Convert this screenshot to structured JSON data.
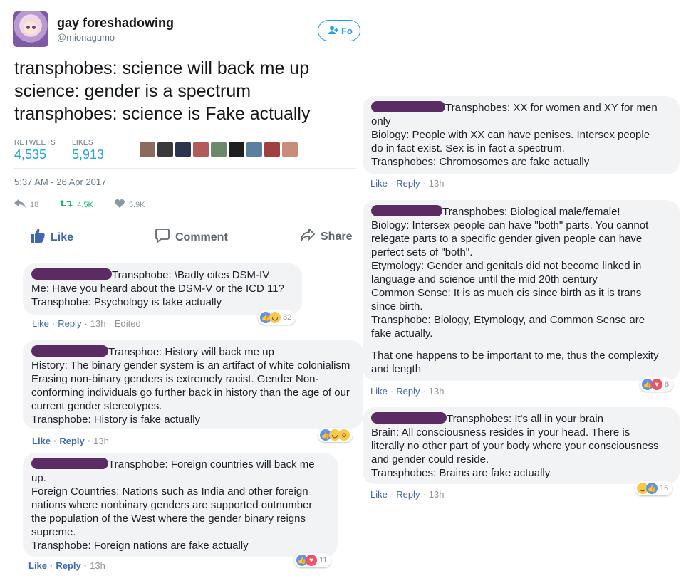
{
  "tweet": {
    "display_name": "gay foreshadowing",
    "handle": "@mionagumo",
    "follow_label": "Fo",
    "lines": [
      "transphobes: science will back me up",
      "science: gender is a spectrum",
      "transphobes: science is Fake actually"
    ],
    "retweets_label": "RETWEETS",
    "retweets_count": "4,535",
    "likes_label": "LIKES",
    "likes_count": "5,913",
    "timestamp": "5:37 AM - 26 Apr 2017",
    "reply_count": "18",
    "retweet_action_count": "4.5K",
    "like_action_count": "5.9K",
    "liker_avatar_colors": [
      "#8a6b5c",
      "#3a3a3a",
      "#2a3550",
      "#b35a5a",
      "#6a8a6a",
      "#1f1f1f",
      "#5a7fa0",
      "#a04040",
      "#c98b7a"
    ]
  },
  "facebook_bar": {
    "like_label": "Like",
    "comment_label": "Comment",
    "share_label": "Share"
  },
  "colors": {
    "twitter_blue": "#1da1f2",
    "facebook_blue": "#4267b2",
    "redaction": "#5b2b63",
    "bubble_bg": "#f2f3f5"
  },
  "left_comments": [
    {
      "lines": [
        "Transphobe: \\Badly cites DSM-IV",
        "Me: Have you heard about the DSM-V or the ICD 11?",
        "Transphobe: Psychology is fake actually"
      ],
      "like": "Like",
      "reply": "Reply",
      "time": "13h",
      "edited": "Edited",
      "reaction_count": "32"
    },
    {
      "lines": [
        "Transphoe: History will back me up",
        "History: The binary gender system is an artifact of white colonialism",
        "Erasing non-binary genders is extremely racist. Gender Non-",
        "conforming individuals go further back in history than the age of our",
        "current gender stereotypes.",
        "Transphobe: History is fake actually"
      ],
      "like": "Like",
      "reply": "Reply",
      "time": "13h",
      "reaction_count": ""
    },
    {
      "lines": [
        "Transphobe: Foreign countries will back me",
        "up.",
        "Foreign Countries: Nations such as India and other foreign",
        "nations where nonbinary genders are supported outnumber",
        "the population of the West where the gender binary reigns",
        "supreme.",
        "Transphobe: Foreign nations are fake actually"
      ],
      "like": "Like",
      "reply": "Reply",
      "time": "13h",
      "reaction_count": "11"
    }
  ],
  "right_comments": [
    {
      "lines": [
        "Transphobes: XX for women and XY for men",
        "only",
        "Biology: People with XX can have penises. Intersex people",
        "do in fact exist. Sex is in fact a spectrum.",
        "Transphobes: Chromosomes are fake actually"
      ],
      "like": "Like",
      "reply": "Reply",
      "time": "13h"
    },
    {
      "lines": [
        "Transphobes: Biological male/female!",
        "Biology: Intersex people can have \"both\" parts. You cannot",
        "relegate parts to a specific gender given people can have",
        "perfect sets of \"both\".",
        "Etymology: Gender and genitals did not become linked in",
        "language and science until the mid 20th century",
        "Common Sense: It is as much cis since birth as it is trans",
        "since birth.",
        "Transphobe: Biology, Etymology, and Common Sense are",
        "fake actually."
      ],
      "extra_lines": [
        "That one happens to be important to me, thus the complexity",
        "and length"
      ],
      "like": "Like",
      "reply": "Reply",
      "time": "13h",
      "reaction_count": "8"
    },
    {
      "lines": [
        "Transphobes: It's all in your brain",
        "Brain: All consciousness resides in your head. There is",
        "literally no other part of your body where your consciousness",
        "and gender could reside.",
        "Transphobes: Brains are fake actually"
      ],
      "like": "Like",
      "reply": "Reply",
      "time": "13h",
      "reaction_count": "16"
    }
  ]
}
